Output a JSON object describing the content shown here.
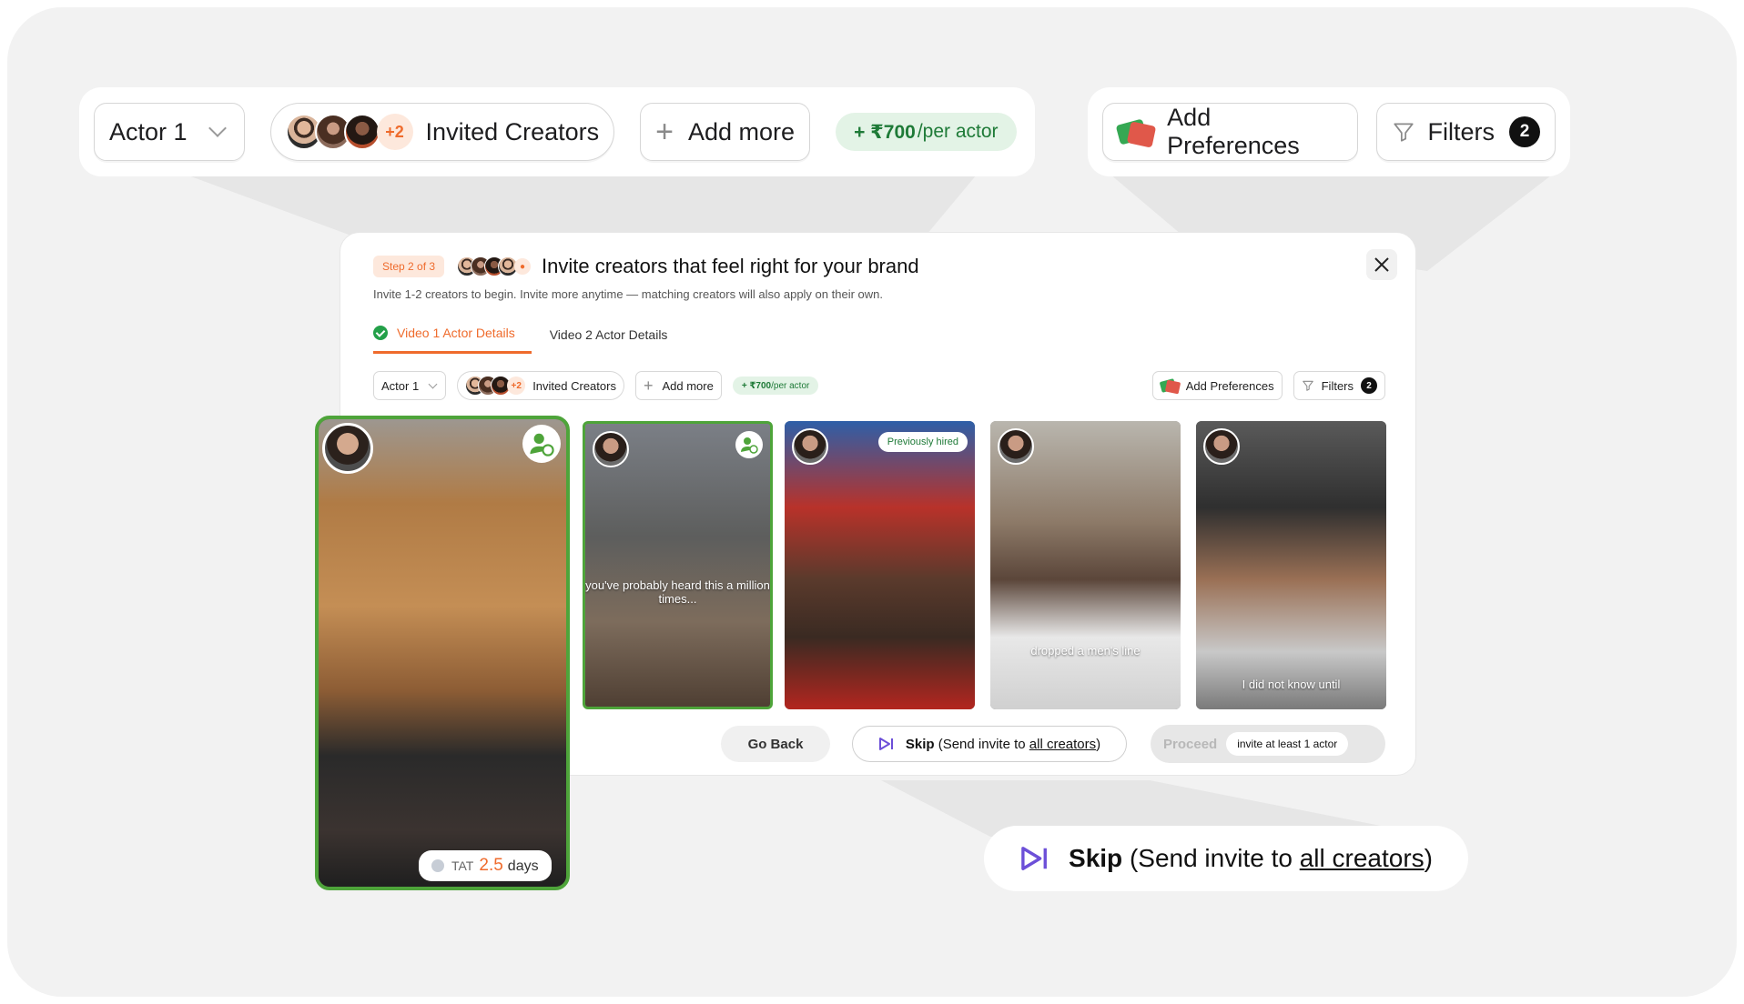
{
  "zoom_toolbar": {
    "actor_label": "Actor 1",
    "invited_more": "+2",
    "invited_label": "Invited Creators",
    "add_more_label": "Add more",
    "price": "+ ₹700",
    "price_per": "/per actor",
    "preferences_label": "Add Preferences",
    "filters_label": "Filters",
    "filters_count": "2"
  },
  "modal": {
    "step_badge": "Step 2 of 3",
    "title": "Invite creators that feel right for your brand",
    "subtitle": "Invite 1-2 creators to begin. Invite more anytime — matching creators will also apply on their own.",
    "tabs": [
      {
        "label": "Video 1 Actor Details",
        "active": true,
        "complete": true
      },
      {
        "label": "Video 2 Actor Details",
        "active": false,
        "complete": false
      }
    ],
    "toolbar": {
      "actor_label": "Actor 1",
      "invited_more": "+2",
      "invited_label": "Invited Creators",
      "add_more_label": "Add more",
      "price": "+ ₹700",
      "price_per": "/per actor",
      "preferences_label": "Add Preferences",
      "filters_label": "Filters",
      "filters_count": "2"
    },
    "cards": [
      {
        "caption": "",
        "badge": "",
        "selected": true
      },
      {
        "caption": "you've probably heard this a million times...",
        "badge": "",
        "selected": true
      },
      {
        "caption": "",
        "badge": "Previously hired",
        "selected": false
      },
      {
        "caption": "dropped a men's line",
        "badge": "",
        "selected": false
      },
      {
        "caption": "I did not know until",
        "badge": "",
        "selected": false
      }
    ],
    "featured_card": {
      "tat_label": "TAT",
      "tat_value": "2.5",
      "tat_unit": "days"
    },
    "footer": {
      "go_back": "Go Back",
      "skip_bold": "Skip",
      "skip_prefix": "(Send invite to ",
      "skip_link": "all creators",
      "skip_suffix": ")",
      "proceed": "Proceed",
      "proceed_hint": "invite at least 1 actor"
    }
  },
  "skip_callout": {
    "bold": "Skip",
    "prefix": "(Send invite to ",
    "link": "all creators",
    "suffix": ")"
  },
  "colors": {
    "accent_orange": "#ef6b2c",
    "success_green": "#4ea43a",
    "price_green": "#1e7a37",
    "skip_purple": "#6c4fd8"
  }
}
